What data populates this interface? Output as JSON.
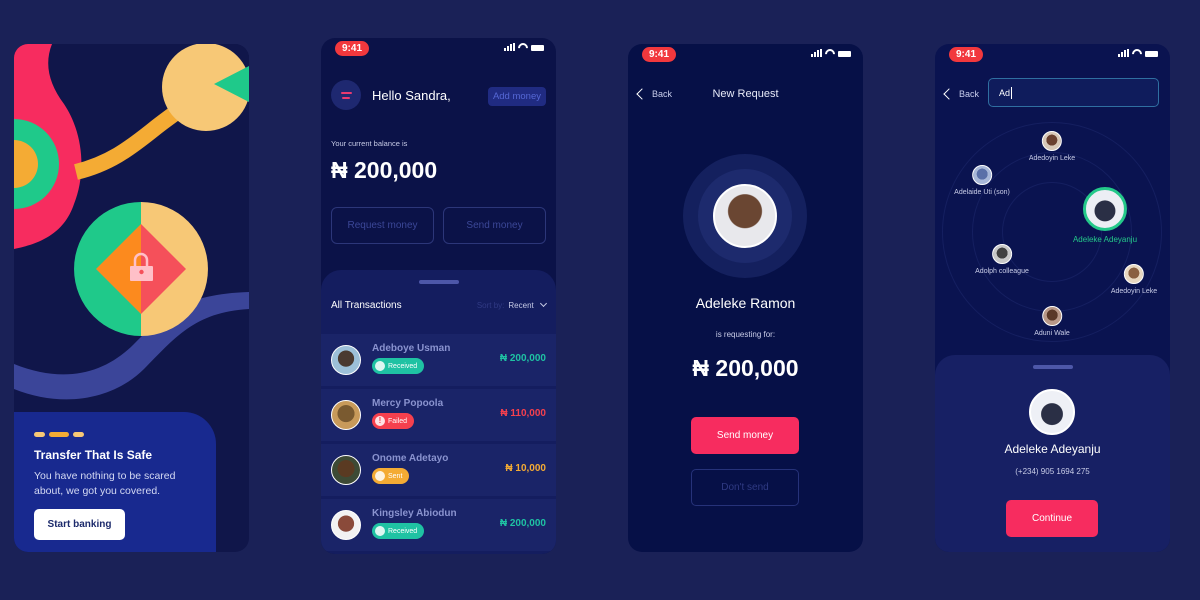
{
  "colors": {
    "page_bg": "#1a2157",
    "accent_pink": "#f72c5f",
    "received": "#1fc2a3",
    "failed": "#f5404e",
    "sent": "#f4ab34",
    "selected": "#24c98a"
  },
  "status_bar": {
    "time": "9:41"
  },
  "onboarding": {
    "title": "Transfer That Is Safe",
    "text": "You have nothing to be scared about, we got you covered.",
    "start_button": "Start banking",
    "icon": "lock-icon"
  },
  "home": {
    "greeting": "Hello Sandra,",
    "add_money": "Add money",
    "balance_label": "Your current balance is",
    "balance": "₦ 200,000",
    "request_button": "Request money",
    "send_button": "Send money",
    "transactions_title": "All Transactions",
    "sort_label": "Sort by:",
    "sort_value": "Recent",
    "transactions": [
      {
        "name": "Adeboye Usman",
        "status": "Received",
        "status_icon": "received-icon",
        "amount": "₦ 200,000",
        "color": "#1fc2a3"
      },
      {
        "name": "Mercy Popoola",
        "status": "Failed",
        "status_icon": "failed-icon",
        "amount": "₦ 110,000",
        "color": "#f5404e"
      },
      {
        "name": "Onome Adetayo",
        "status": "Sent",
        "status_icon": "sent-icon",
        "amount": "₦ 10,000",
        "color": "#f4ab34"
      },
      {
        "name": "Kingsley Abiodun",
        "status": "Received",
        "status_icon": "received-icon",
        "amount": "₦ 200,000",
        "color": "#1fc2a3"
      }
    ]
  },
  "request": {
    "back": "Back",
    "title": "New Request",
    "name": "Adeleke Ramon",
    "subtitle": "is requesting for:",
    "amount": "₦ 200,000",
    "send_button": "Send money",
    "decline_button": "Don't send"
  },
  "search": {
    "back": "Back",
    "query": "Ad",
    "contacts": [
      {
        "name": "Adedoyin Leke"
      },
      {
        "name": "Adelaide Uti (son)"
      },
      {
        "name": "Adeleke Adeyanju",
        "selected": true
      },
      {
        "name": "Adolph colleague"
      },
      {
        "name": "Adedoyin Leke"
      },
      {
        "name": "Aduni Wale"
      }
    ],
    "selected_name": "Adeleke Adeyanju",
    "selected_phone": "(+234) 905 1694 275",
    "continue_button": "Continue"
  }
}
